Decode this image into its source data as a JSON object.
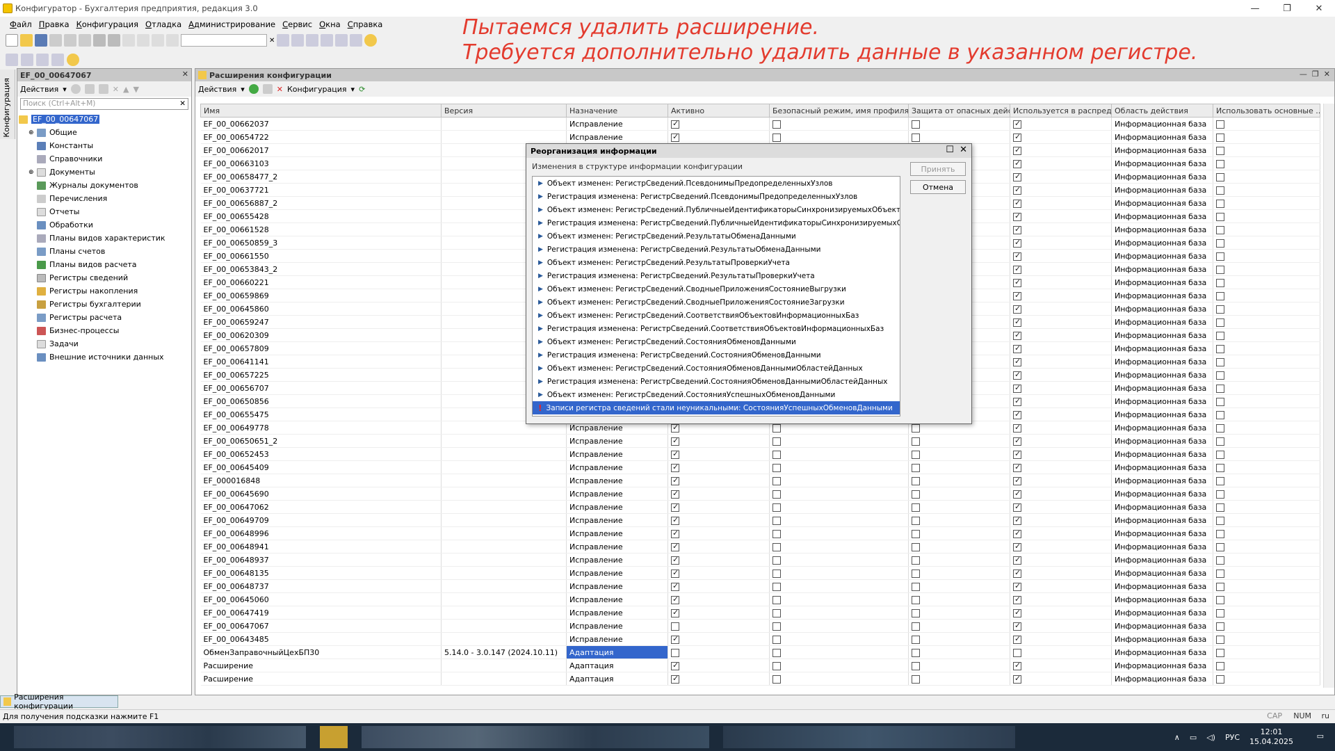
{
  "window": {
    "title": "Конфигуратор - Бухгалтерия предприятия, редакция 3.0"
  },
  "menu": [
    "Файл",
    "Правка",
    "Конфигурация",
    "Отладка",
    "Администрирование",
    "Сервис",
    "Окна",
    "Справка"
  ],
  "annotation": {
    "line1": "Пытаемся удалить расширение.",
    "line2": "Требуется дополнительно удалить данные в указанном регистре."
  },
  "left_panel": {
    "vertical_tab": "Конфигурация",
    "title": "EF_00_00647067",
    "actions_label": "Действия",
    "search_placeholder": "Поиск (Ctrl+Alt+M)",
    "root": "EF_00_00647067",
    "items": [
      "Общие",
      "Константы",
      "Справочники",
      "Документы",
      "Журналы документов",
      "Перечисления",
      "Отчеты",
      "Обработки",
      "Планы видов характеристик",
      "Планы счетов",
      "Планы видов расчета",
      "Регистры сведений",
      "Регистры накопления",
      "Регистры бухгалтерии",
      "Регистры расчета",
      "Бизнес-процессы",
      "Задачи",
      "Внешние источники данных"
    ]
  },
  "main": {
    "title": "Расширения конфигурации",
    "actions_label": "Действия",
    "config_label": "Конфигурация",
    "columns": [
      "Имя",
      "Версия",
      "Назначение",
      "Активно",
      "Безопасный режим, имя профиля б...",
      "Защита от опасных дейст...",
      "Используется в распреде...",
      "Область действия",
      "Использовать основные ..."
    ],
    "rows": [
      {
        "name": "EF_00_00662037",
        "version": "",
        "purpose": "Исправление",
        "active": true,
        "safe": false,
        "protect": false,
        "used": true,
        "scope": "Информационная база",
        "main": false
      },
      {
        "name": "EF_00_00654722",
        "version": "",
        "purpose": "Исправление",
        "active": true,
        "safe": false,
        "protect": false,
        "used": true,
        "scope": "Информационная база",
        "main": false
      },
      {
        "name": "EF_00_00662017",
        "version": "",
        "purpose": "",
        "active": false,
        "safe": false,
        "protect": false,
        "used": true,
        "scope": "Информационная база",
        "main": false
      },
      {
        "name": "EF_00_00663103",
        "version": "",
        "purpose": "",
        "active": false,
        "safe": false,
        "protect": false,
        "used": true,
        "scope": "Информационная база",
        "main": false
      },
      {
        "name": "EF_00_00658477_2",
        "version": "",
        "purpose": "",
        "active": false,
        "safe": false,
        "protect": false,
        "used": true,
        "scope": "Информационная база",
        "main": false
      },
      {
        "name": "EF_00_00637721",
        "version": "",
        "purpose": "",
        "active": false,
        "safe": false,
        "protect": false,
        "used": true,
        "scope": "Информационная база",
        "main": false
      },
      {
        "name": "EF_00_00656887_2",
        "version": "",
        "purpose": "",
        "active": false,
        "safe": false,
        "protect": false,
        "used": true,
        "scope": "Информационная база",
        "main": false
      },
      {
        "name": "EF_00_00655428",
        "version": "",
        "purpose": "",
        "active": false,
        "safe": false,
        "protect": false,
        "used": true,
        "scope": "Информационная база",
        "main": false
      },
      {
        "name": "EF_00_00661528",
        "version": "",
        "purpose": "",
        "active": false,
        "safe": false,
        "protect": false,
        "used": true,
        "scope": "Информационная база",
        "main": false
      },
      {
        "name": "EF_00_00650859_3",
        "version": "",
        "purpose": "",
        "active": false,
        "safe": false,
        "protect": false,
        "used": true,
        "scope": "Информационная база",
        "main": false
      },
      {
        "name": "EF_00_00661550",
        "version": "",
        "purpose": "",
        "active": false,
        "safe": false,
        "protect": false,
        "used": true,
        "scope": "Информационная база",
        "main": false
      },
      {
        "name": "EF_00_00653843_2",
        "version": "",
        "purpose": "",
        "active": false,
        "safe": false,
        "protect": false,
        "used": true,
        "scope": "Информационная база",
        "main": false
      },
      {
        "name": "EF_00_00660221",
        "version": "",
        "purpose": "",
        "active": false,
        "safe": false,
        "protect": false,
        "used": true,
        "scope": "Информационная база",
        "main": false
      },
      {
        "name": "EF_00_00659869",
        "version": "",
        "purpose": "",
        "active": false,
        "safe": false,
        "protect": false,
        "used": true,
        "scope": "Информационная база",
        "main": false
      },
      {
        "name": "EF_00_00645860",
        "version": "",
        "purpose": "",
        "active": false,
        "safe": false,
        "protect": false,
        "used": true,
        "scope": "Информационная база",
        "main": false
      },
      {
        "name": "EF_00_00659247",
        "version": "",
        "purpose": "",
        "active": false,
        "safe": false,
        "protect": false,
        "used": true,
        "scope": "Информационная база",
        "main": false
      },
      {
        "name": "EF_00_00620309",
        "version": "",
        "purpose": "",
        "active": false,
        "safe": false,
        "protect": false,
        "used": true,
        "scope": "Информационная база",
        "main": false
      },
      {
        "name": "EF_00_00657809",
        "version": "",
        "purpose": "",
        "active": false,
        "safe": false,
        "protect": false,
        "used": true,
        "scope": "Информационная база",
        "main": false
      },
      {
        "name": "EF_00_00641141",
        "version": "",
        "purpose": "",
        "active": false,
        "safe": false,
        "protect": false,
        "used": true,
        "scope": "Информационная база",
        "main": false
      },
      {
        "name": "EF_00_00657225",
        "version": "",
        "purpose": "",
        "active": false,
        "safe": false,
        "protect": false,
        "used": true,
        "scope": "Информационная база",
        "main": false
      },
      {
        "name": "EF_00_00656707",
        "version": "",
        "purpose": "",
        "active": false,
        "safe": false,
        "protect": false,
        "used": true,
        "scope": "Информационная база",
        "main": false
      },
      {
        "name": "EF_00_00650856",
        "version": "",
        "purpose": "",
        "active": false,
        "safe": false,
        "protect": false,
        "used": true,
        "scope": "Информационная база",
        "main": false
      },
      {
        "name": "EF_00_00655475",
        "version": "",
        "purpose": "",
        "active": false,
        "safe": false,
        "protect": false,
        "used": true,
        "scope": "Информационная база",
        "main": false
      },
      {
        "name": "EF_00_00649778",
        "version": "",
        "purpose": "Исправление",
        "active": true,
        "safe": false,
        "protect": false,
        "used": true,
        "scope": "Информационная база",
        "main": false
      },
      {
        "name": "EF_00_00650651_2",
        "version": "",
        "purpose": "Исправление",
        "active": true,
        "safe": false,
        "protect": false,
        "used": true,
        "scope": "Информационная база",
        "main": false
      },
      {
        "name": "EF_00_00652453",
        "version": "",
        "purpose": "Исправление",
        "active": true,
        "safe": false,
        "protect": false,
        "used": true,
        "scope": "Информационная база",
        "main": false
      },
      {
        "name": "EF_00_00645409",
        "version": "",
        "purpose": "Исправление",
        "active": true,
        "safe": false,
        "protect": false,
        "used": true,
        "scope": "Информационная база",
        "main": false
      },
      {
        "name": "EF_000016848",
        "version": "",
        "purpose": "Исправление",
        "active": true,
        "safe": false,
        "protect": false,
        "used": true,
        "scope": "Информационная база",
        "main": false
      },
      {
        "name": "EF_00_00645690",
        "version": "",
        "purpose": "Исправление",
        "active": true,
        "safe": false,
        "protect": false,
        "used": true,
        "scope": "Информационная база",
        "main": false
      },
      {
        "name": "EF_00_00647062",
        "version": "",
        "purpose": "Исправление",
        "active": true,
        "safe": false,
        "protect": false,
        "used": true,
        "scope": "Информационная база",
        "main": false
      },
      {
        "name": "EF_00_00649709",
        "version": "",
        "purpose": "Исправление",
        "active": true,
        "safe": false,
        "protect": false,
        "used": true,
        "scope": "Информационная база",
        "main": false
      },
      {
        "name": "EF_00_00648996",
        "version": "",
        "purpose": "Исправление",
        "active": true,
        "safe": false,
        "protect": false,
        "used": true,
        "scope": "Информационная база",
        "main": false
      },
      {
        "name": "EF_00_00648941",
        "version": "",
        "purpose": "Исправление",
        "active": true,
        "safe": false,
        "protect": false,
        "used": true,
        "scope": "Информационная база",
        "main": false
      },
      {
        "name": "EF_00_00648937",
        "version": "",
        "purpose": "Исправление",
        "active": true,
        "safe": false,
        "protect": false,
        "used": true,
        "scope": "Информационная база",
        "main": false
      },
      {
        "name": "EF_00_00648135",
        "version": "",
        "purpose": "Исправление",
        "active": true,
        "safe": false,
        "protect": false,
        "used": true,
        "scope": "Информационная база",
        "main": false
      },
      {
        "name": "EF_00_00648737",
        "version": "",
        "purpose": "Исправление",
        "active": true,
        "safe": false,
        "protect": false,
        "used": true,
        "scope": "Информационная база",
        "main": false
      },
      {
        "name": "EF_00_00645060",
        "version": "",
        "purpose": "Исправление",
        "active": true,
        "safe": false,
        "protect": false,
        "used": true,
        "scope": "Информационная база",
        "main": false
      },
      {
        "name": "EF_00_00647419",
        "version": "",
        "purpose": "Исправление",
        "active": true,
        "safe": false,
        "protect": false,
        "used": true,
        "scope": "Информационная база",
        "main": false
      },
      {
        "name": "EF_00_00647067",
        "version": "",
        "purpose": "Исправление",
        "active": false,
        "safe": false,
        "protect": false,
        "used": true,
        "scope": "Информационная база",
        "main": false
      },
      {
        "name": "EF_00_00643485",
        "version": "",
        "purpose": "Исправление",
        "active": true,
        "safe": false,
        "protect": false,
        "used": true,
        "scope": "Информационная база",
        "main": false
      },
      {
        "name": "ОбменЗаправочныйЦехБП30",
        "version": "5.14.0 - 3.0.147 (2024.10.11)",
        "purpose": "Адаптация",
        "active": false,
        "safe": false,
        "protect": false,
        "used": false,
        "scope": "Информационная база",
        "main": false,
        "selected": true
      },
      {
        "name": "Расширение",
        "version": "",
        "purpose": "Адаптация",
        "active": true,
        "safe": false,
        "protect": false,
        "used": true,
        "scope": "Информационная база",
        "main": false
      },
      {
        "name": "Расширение",
        "version": "",
        "purpose": "Адаптация",
        "active": true,
        "safe": false,
        "protect": false,
        "used": true,
        "scope": "Информационная база",
        "main": false
      }
    ]
  },
  "dialog": {
    "title": "Реорганизация информации",
    "subtitle": "Изменения в структуре информации конфигурации",
    "accept": "Принять",
    "cancel": "Отмена",
    "items": [
      "Объект изменен: РегистрСведений.ПсевдонимыПредопределенныхУзлов",
      "Регистрация изменена: РегистрСведений.ПсевдонимыПредопределенныхУзлов",
      "Объект изменен: РегистрСведений.ПубличныеИдентификаторыСинхронизируемыхОбъектов",
      "Регистрация изменена: РегистрСведений.ПубличныеИдентификаторыСинхронизируемыхОб...",
      "Объект изменен: РегистрСведений.РезультатыОбменаДанными",
      "Регистрация изменена: РегистрСведений.РезультатыОбменаДанными",
      "Объект изменен: РегистрСведений.РезультатыПроверкиУчета",
      "Регистрация изменена: РегистрСведений.РезультатыПроверкиУчета",
      "Объект изменен: РегистрСведений.СводныеПриложенияСостояниеВыгрузки",
      "Объект изменен: РегистрСведений.СводныеПриложенияСостояниеЗагрузки",
      "Объект изменен: РегистрСведений.СоответствияОбъектовИнформационныхБаз",
      "Регистрация изменена: РегистрСведений.СоответствияОбъектовИнформационныхБаз",
      "Объект изменен: РегистрСведений.СостоянияОбменовДанными",
      "Регистрация изменена: РегистрСведений.СостоянияОбменовДанными",
      "Объект изменен: РегистрСведений.СостоянияОбменовДаннымиОбластейДанных",
      "Регистрация изменена: РегистрСведений.СостоянияОбменовДаннымиОбластейДанных",
      "Объект изменен: РегистрСведений.СостоянияУспешныхОбменовДанными"
    ],
    "error_item": "Записи регистра сведений стали неуникальными: СостоянияУспешныхОбменовДанными"
  },
  "bottom_tab": "Расширения конфигурации",
  "status": {
    "hint": "Для получения подсказки нажмите F1",
    "cap": "CAP",
    "num": "NUM",
    "lang": "ru"
  },
  "tray": {
    "lang": "РУС",
    "time": "12:01",
    "date": "15.04.2025"
  }
}
